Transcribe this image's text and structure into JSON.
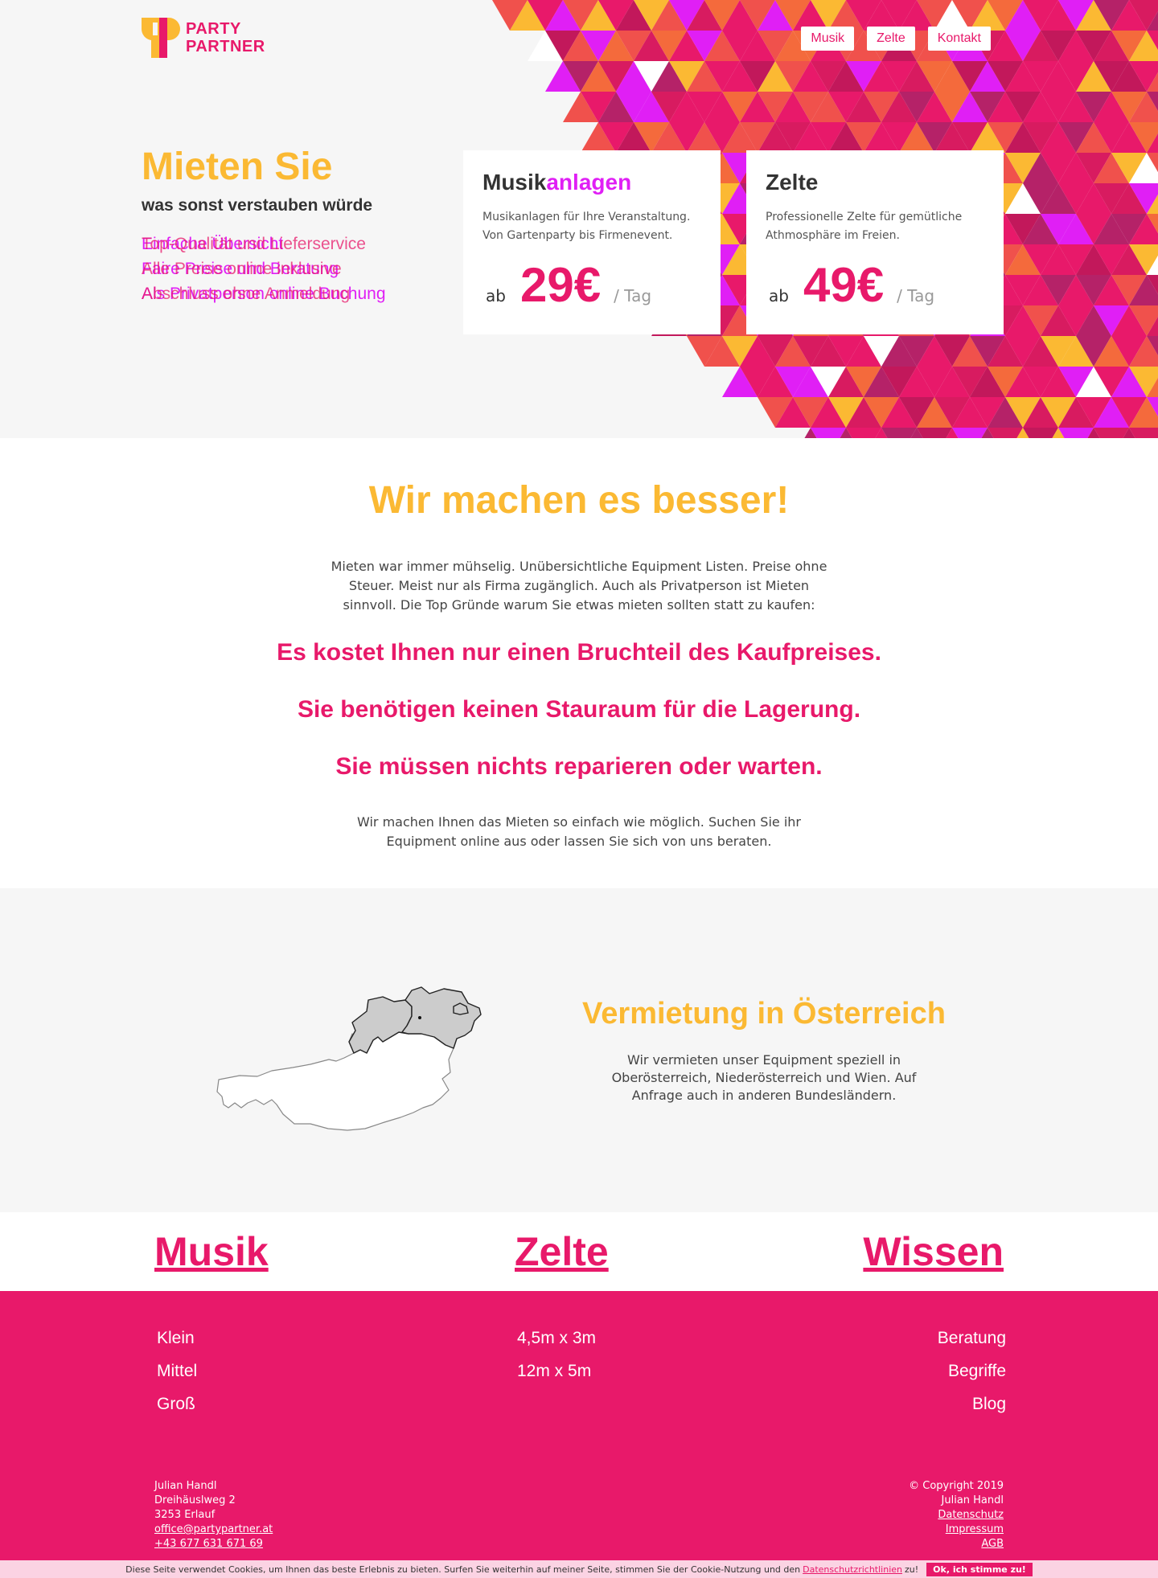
{
  "brand": {
    "logo_line1": "PARTY",
    "logo_line2": "PARTNER",
    "colors": {
      "pink": "#e8196a",
      "magenta": "#e01ff5",
      "orange": "#fbb933",
      "coral": "#f0514c",
      "purple": "#b52268"
    }
  },
  "nav": {
    "items": [
      {
        "label": "Musik"
      },
      {
        "label": "Zelte"
      },
      {
        "label": "Kontakt"
      }
    ]
  },
  "hero": {
    "title": "Mieten Sie",
    "subtitle": "was sonst verstauben würde",
    "lines_a": [
      "Einfache Übersicht",
      "Faire Preise und Beratung",
      "Als Privatperson online Buchung"
    ],
    "lines_b": [
      "Top-Qualität und Lieferservice",
      "Alle Preise online inklusive",
      "Abschluss ohne Anmeldung"
    ]
  },
  "cards": [
    {
      "title_main": "Musik",
      "title_accent": "anlagen",
      "description": "Musikanlagen für Ihre Veranstaltung. Von Gartenparty bis Firmenevent.",
      "ab": "ab",
      "price": "29€",
      "per": "/ Tag"
    },
    {
      "title_main": "Zelte",
      "title_accent": "",
      "description": "Professionelle Zelte für gemütliche Athmosphäre im Freien.",
      "ab": "ab",
      "price": "49€",
      "per": "/ Tag"
    }
  ],
  "why": {
    "title": "Wir machen es besser!",
    "intro": "Mieten war immer mühselig. Unübersichtliche Equipment Listen. Preise ohne Steuer. Meist nur als Firma zugänglich. Auch als Privatperson ist Mieten sinnvoll. Die Top Gründe warum Sie etwas mieten sollten statt zu kaufen:",
    "reasons": [
      "Es kostet Ihnen nur einen Bruchteil des Kaufpreises.",
      "Sie benötigen keinen Stauraum für die Lagerung.",
      "Sie müssen nichts reparieren oder warten."
    ],
    "outro": "Wir machen Ihnen das Mieten so einfach wie möglich. Suchen Sie ihr Equipment online aus oder lassen Sie sich von uns beraten."
  },
  "austria": {
    "title": "Vermietung in Österreich",
    "text": "Wir vermieten unser Equipment speziell in Oberösterreich, Niederösterreich und Wien. Auf Anfrage auch in anderen Bundesländern."
  },
  "categories": {
    "musik": {
      "heading": "Musik",
      "links": [
        "Klein",
        "Mittel",
        "Groß"
      ]
    },
    "zelte": {
      "heading": "Zelte",
      "links": [
        "4,5m x 3m",
        "12m x 5m"
      ]
    },
    "wissen": {
      "heading": "Wissen",
      "links": [
        "Beratung",
        "Begriffe",
        "Blog"
      ]
    }
  },
  "footer": {
    "name": "Julian Handl",
    "street": "Dreihäuslweg 2",
    "city": "3253 Erlauf",
    "email": "office@partypartner.at",
    "phone": "+43 677 631 671 69",
    "copyright": "© Copyright 2019",
    "copyright_name": "Julian Handl",
    "links": [
      "Datenschutz",
      "Impressum",
      "AGB"
    ]
  },
  "cookie": {
    "text": "Diese Seite verwendet Cookies, um Ihnen das beste Erlebnis zu bieten. Surfen Sie weiterhin auf meiner Seite, stimmen Sie der Cookie-Nutzung und den",
    "link": "Datenschutzrichtlinien",
    "suffix": "zu!",
    "button": "Ok, ich stimme zu!"
  }
}
